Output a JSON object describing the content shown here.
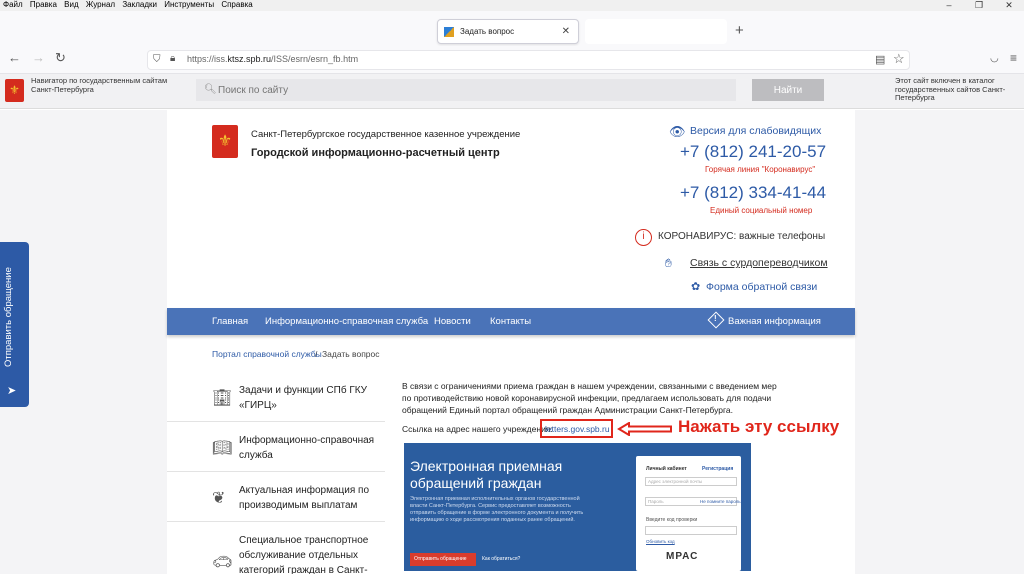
{
  "browser": {
    "menu": [
      "Файл",
      "Правка",
      "Вид",
      "Журнал",
      "Закладки",
      "Инструменты",
      "Справка"
    ],
    "window_controls": [
      "–",
      "❐",
      "✕"
    ],
    "tab_title": "Задать вопрос",
    "tab_close": "✕",
    "new_tab": "+",
    "url_prefix": "https://iss.",
    "url_domain": "ktsz.spb.ru",
    "url_path": "/ISS/esrn/esrn_fb.htm"
  },
  "govbar": {
    "navigator_text": "Навигатор по государственным сайтам Санкт-Петербурга",
    "search_placeholder": "Поиск по сайту",
    "search_button": "Найти",
    "catalog_note": "Этот сайт включен в каталог государственных сайтов Санкт-Петербурга"
  },
  "sidetab": {
    "label": "Отправить обращение"
  },
  "header": {
    "org_line1": "Санкт-Петербургское государственное казенное учреждение",
    "org_line2": "Городской информационно-расчетный центр",
    "low_vision": "Версия для слабовидящих",
    "phone1": "+7 (812) 241-20-57",
    "phone1_note": "Горячая линия \"Коронавирус\"",
    "phone2": "+7 (812) 334-41-44",
    "phone2_note": "Единый социальный номер",
    "corona_link": "КОРОНАВИРУС: важные телефоны",
    "sign_link": "Связь с сурдопереводчиком",
    "feedback_link": "Форма обратной связи"
  },
  "nav": {
    "items": [
      "Главная",
      "Информационно-справочная служба",
      "Новости",
      "Контакты"
    ],
    "important": "Важная информация"
  },
  "breadcrumb": {
    "home": "Портал справочной службы",
    "separator": "/",
    "current": "Задать вопрос"
  },
  "left_menu": [
    {
      "label": "Задачи и функции СПб ГКУ «ГИРЦ»",
      "icon": "building-icon"
    },
    {
      "label": "Информационно-справочная служба",
      "icon": "book-icon"
    },
    {
      "label": "Актуальная информация по производимым выплатам",
      "icon": "leaf-icon"
    },
    {
      "label": "Специальное транспортное обслуживание отдельных категорий граждан в Санкт-",
      "icon": "car-icon"
    }
  ],
  "main": {
    "info": "В связи с ограничениями приема граждан в нашем учреждении, связанными с введением мер по противодействию новой коронавирусной инфекции, предлагаем использовать для подачи обращений Единый портал обращений граждан Администрации Санкт-Петербурга.",
    "link_label": "Ссылка на адрес нашего учреждения:",
    "link_url": "letters.gov.spb.ru",
    "callout": "Нажать эту ссылку"
  },
  "embed": {
    "title1": "Электронная приемная",
    "title2": "обращений граждан",
    "text": "Электронная приемная исполнительных органов государственной власти Санкт-Петербурга. Сервис предоставляет возможность отправить обращение в форме электронного документа и получить информацию о ходе рассмотрения поданных ранее обращений.",
    "button": "Отправить обращение",
    "ask": "Как обратиться?",
    "form_tab1": "Личный кабинет",
    "form_tab2": "Регистрация",
    "form_email": "Адрес электронной почты",
    "form_password": "Пароль",
    "form_forgot": "Не помните пароль?",
    "form_captcha": "Введите код проверки",
    "form_refresh": "Обновить код",
    "form_captcha_text": "МРАС"
  },
  "colors": {
    "accent": "#2d5aa6",
    "nav": "#4a73b8",
    "red": "#d42b1e",
    "callout": "#e0261b"
  }
}
